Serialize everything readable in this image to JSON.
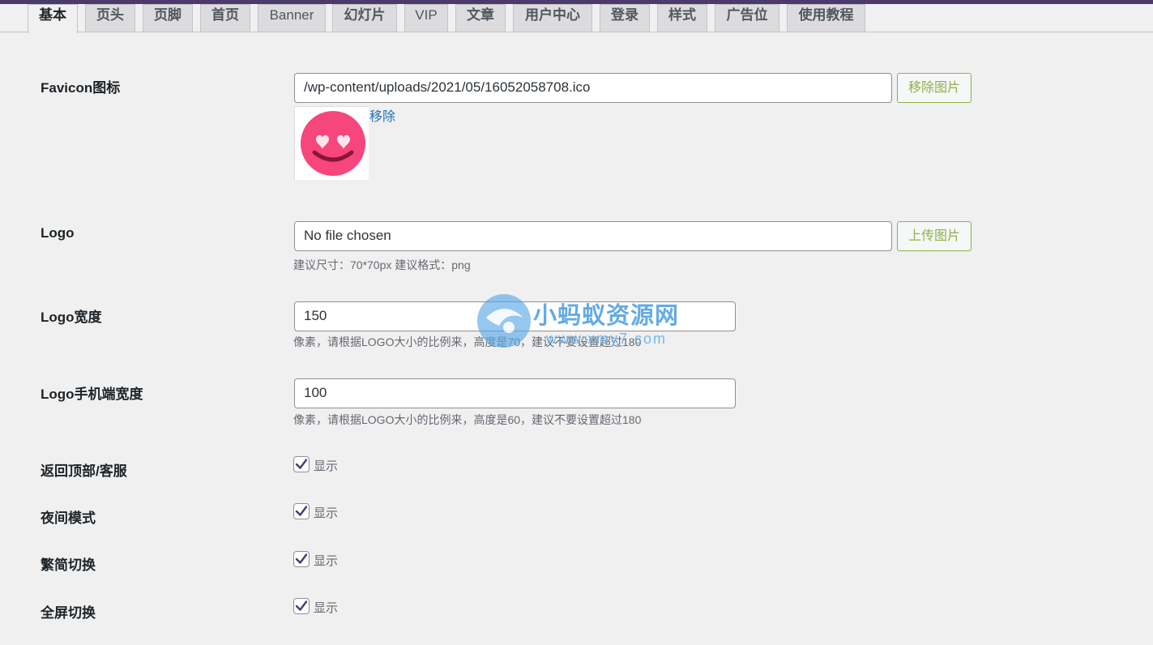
{
  "tabs": [
    {
      "label": "基本",
      "active": true
    },
    {
      "label": "页头"
    },
    {
      "label": "页脚"
    },
    {
      "label": "首页"
    },
    {
      "label": "Banner"
    },
    {
      "label": "幻灯片"
    },
    {
      "label": "VIP"
    },
    {
      "label": "文章"
    },
    {
      "label": "用户中心"
    },
    {
      "label": "登录"
    },
    {
      "label": "样式"
    },
    {
      "label": "广告位"
    },
    {
      "label": "使用教程"
    }
  ],
  "favicon": {
    "label": "Favicon图标",
    "value": "/wp-content/uploads/2021/05/16052058708.ico",
    "button": "移除图片",
    "remove_link": "移除",
    "preview_icon": "heart-eyes-emoji-icon"
  },
  "logo": {
    "label": "Logo",
    "value": "No file chosen",
    "button": "上传图片",
    "hint": "建议尺寸：70*70px 建议格式：png"
  },
  "logo_width": {
    "label": "Logo宽度",
    "value": "150",
    "hint": "像素，请根据LOGO大小的比例来，高度是70，建议不要设置超过180"
  },
  "logo_mobile_width": {
    "label": "Logo手机端宽度",
    "value": "100",
    "hint": "像素，请根据LOGO大小的比例来，高度是60，建议不要设置超过180"
  },
  "toggles": [
    {
      "label": "返回顶部/客服",
      "option": "显示",
      "checked": true
    },
    {
      "label": "夜间模式",
      "option": "显示",
      "checked": true
    },
    {
      "label": "繁简切换",
      "option": "显示",
      "checked": true
    },
    {
      "label": "全屏切换",
      "option": "显示",
      "checked": true
    }
  ],
  "watermark": {
    "title": "小蚂蚁资源网",
    "url": "www.xmy7.com"
  },
  "colors": {
    "admin_bar": "#4b3a6b",
    "button_accent": "#8fb14a",
    "link": "#2271b1",
    "checkmark": "#4b3a6b"
  }
}
